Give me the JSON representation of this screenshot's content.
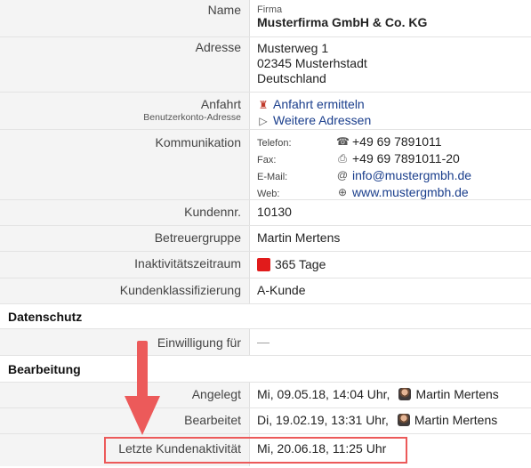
{
  "company": {
    "label": "Name",
    "type_label": "Firma",
    "name": "Musterfirma GmbH & Co. KG"
  },
  "address": {
    "label": "Adresse",
    "lines": [
      "Musterweg 1",
      "02345 Musterhstadt",
      "Deutschland"
    ]
  },
  "directions": {
    "label": "Anfahrt",
    "sublabel": "Benutzerkonto-Adresse",
    "link1": "Anfahrt ermitteln",
    "link2": "Weitere Adressen"
  },
  "communication": {
    "label": "Kommunikation",
    "items": [
      {
        "key": "Telefon:",
        "icon": "phone-icon",
        "value": "+49 69 7891011"
      },
      {
        "key": "Fax:",
        "icon": "fax-icon",
        "value": "+49 69 7891011-20"
      },
      {
        "key": "E-Mail:",
        "icon": "at-icon",
        "value": "info@mustergmbh.de"
      },
      {
        "key": "Web:",
        "icon": "globe-icon",
        "value": "www.mustergmbh.de"
      }
    ]
  },
  "customer_number": {
    "label": "Kundennr.",
    "value": "10130"
  },
  "supervisor_group": {
    "label": "Betreuergruppe",
    "value": "Martin Mertens"
  },
  "inactivity": {
    "label": "Inaktivitätszeitraum",
    "value": "365 Tage",
    "color": "#e11b1b"
  },
  "classification": {
    "label": "Kundenklassifizierung",
    "value": "A-Kunde"
  },
  "privacy": {
    "heading": "Datenschutz",
    "consent_label": "Einwilligung für",
    "consent_value": "—"
  },
  "editing": {
    "heading": "Bearbeitung",
    "created_label": "Angelegt",
    "created_value": "Mi, 09.05.18, 14:04 Uhr,",
    "created_user": "Martin Mertens",
    "edited_label": "Bearbeitet",
    "edited_value": "Di, 19.02.19, 13:31 Uhr,",
    "edited_user": "Martin Mertens",
    "last_activity_label": "Letzte Kundenaktivität",
    "last_activity_value": "Mi, 20.06.18, 11:25 Uhr"
  },
  "annotation": {
    "color": "#ec5a5a"
  }
}
